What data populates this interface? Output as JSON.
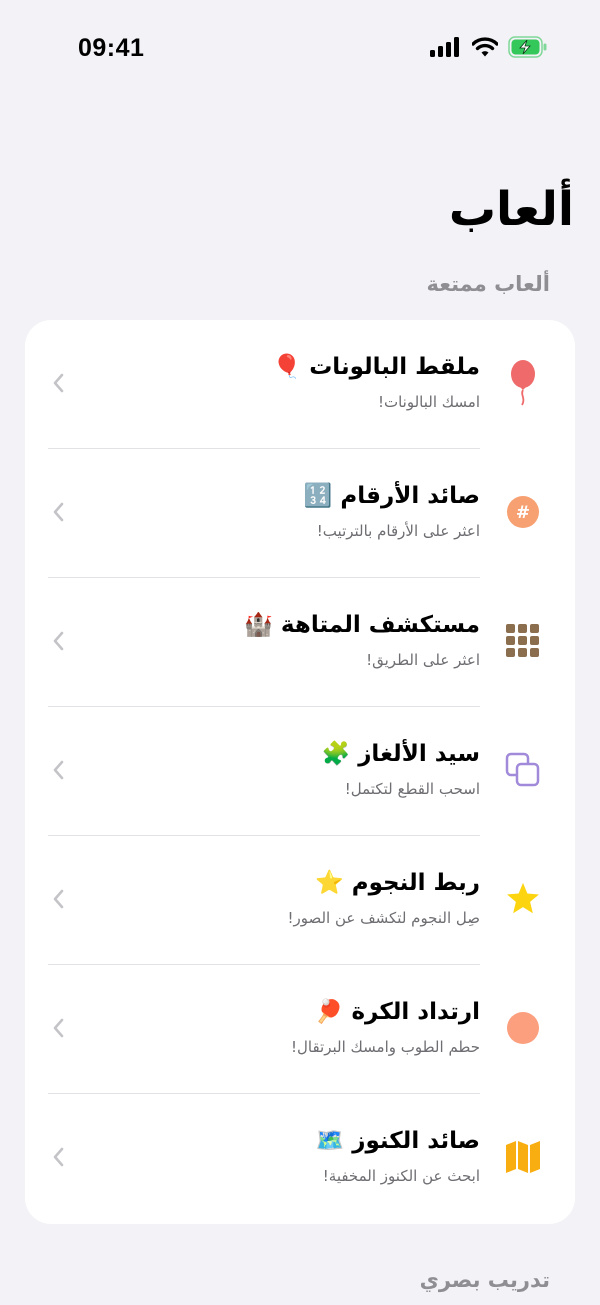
{
  "status_bar": {
    "time": "09:41",
    "icons": [
      "cellular-signal-icon",
      "wifi-icon",
      "battery-charging-icon"
    ]
  },
  "page": {
    "title": "ألعاب"
  },
  "sections": [
    {
      "header": "ألعاب ممتعة",
      "items": [
        {
          "title": "ملقط البالونات 🎈",
          "subtitle": "امسك البالونات!",
          "icon": "balloon-icon",
          "color": "#ef6b6b"
        },
        {
          "title": "صائد الأرقام 🔢",
          "subtitle": "اعثر على الأرقام بالترتيب!",
          "icon": "number-sign-icon",
          "color": "#f7a072"
        },
        {
          "title": "مستكشف المتاهة 🏰",
          "subtitle": "اعثر على الطريق!",
          "icon": "grid-icon",
          "color": "#8b6e4e"
        },
        {
          "title": "سيد الألغاز 🧩",
          "subtitle": "اسحب القطع لتكتمل!",
          "icon": "overlapping-squares-icon",
          "color": "#a08ad9"
        },
        {
          "title": "ربط النجوم ⭐",
          "subtitle": "صِل النجوم لتكشف عن الصور!",
          "icon": "star-icon",
          "color": "#fcd40f"
        },
        {
          "title": "ارتداد الكرة 🏓",
          "subtitle": "حطم الطوب وامسك البرتقال!",
          "icon": "circle-icon",
          "color": "#fb9f7e"
        },
        {
          "title": "صائد الكنوز 🗺️",
          "subtitle": "ابحث عن الكنوز المخفية!",
          "icon": "map-icon",
          "color": "#f8ad10"
        }
      ]
    },
    {
      "header": "تدريب بصري"
    }
  ]
}
